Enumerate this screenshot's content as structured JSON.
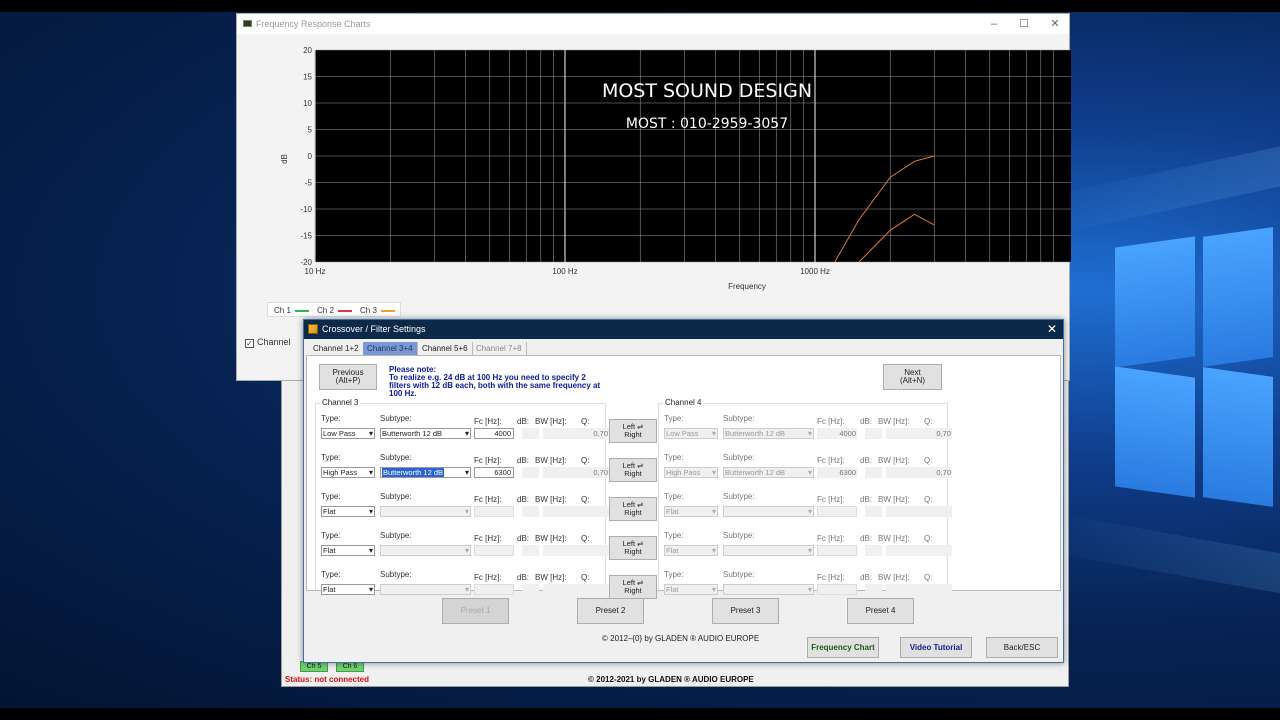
{
  "freq_window": {
    "title": "Frequency Response Charts",
    "controls": [
      "–",
      "☐",
      "✕"
    ],
    "y_label": "dB",
    "x_label": "Frequency",
    "y_ticks": [
      "20",
      "15",
      "10",
      "5",
      "0",
      "-5",
      "-10",
      "-15",
      "-20"
    ],
    "x_ticks": [
      "10 Hz",
      "100 Hz",
      "1000 Hz"
    ],
    "overlay_title": "MOST SOUND DESIGN",
    "overlay_contact": "MOST : 010-2959-3057",
    "legend": [
      {
        "label": "Ch 1",
        "color": "#2db84a"
      },
      {
        "label": "Ch 2",
        "color": "#d8344a"
      },
      {
        "label": "Ch 3",
        "color": "#f0a020"
      }
    ],
    "channel_checkbox": "Channel"
  },
  "chart_data": {
    "type": "line",
    "xlabel": "Frequency",
    "ylabel": "dB",
    "x_scale": "log",
    "xlim": [
      10,
      3000
    ],
    "ylim": [
      -20,
      20
    ],
    "grid": true,
    "series": [
      {
        "color": "#e07a40",
        "x": [
          1200,
          1500,
          2000,
          2500,
          3000
        ],
        "values": [
          -20,
          -12,
          -4,
          -1,
          0
        ]
      },
      {
        "color": "#e07a40",
        "x": [
          1500,
          2000,
          2500,
          3000
        ],
        "values": [
          -20,
          -14,
          -11,
          -13
        ]
      }
    ]
  },
  "bg_app": {
    "status": "Status: not connected",
    "copyright": "© 2012-2021 by GLADEN ® AUDIO EUROPE",
    "buttons": [
      "Ch 5",
      "Ch 6"
    ]
  },
  "crossover": {
    "title": "Crossover / Filter Settings",
    "close": "✕",
    "tabs": [
      "Channel 1+2",
      "Channel 3+4",
      "Channel 5+6",
      "Channel 7+8"
    ],
    "prev_button": "Previous\n(Alt+P)",
    "next_button": "Next\n(Alt+N)",
    "note_title": "Please note:",
    "note_text": "To realize e.g. 24 dB at 100 Hz you need to specify 2 filters with 12 dB each, both with the same frequency at 100 Hz.",
    "left_channel": "Channel 3",
    "right_channel": "Channel 4",
    "labels": {
      "type": "Type:",
      "subtype": "Subtype:",
      "fc": "Fc [Hz]:",
      "db": "dB:",
      "bw": "BW [Hz]:",
      "q": "Q:"
    },
    "lr_button": "Left ⇌\nRight",
    "rows": [
      {
        "type": "Low Pass",
        "subtype": "Butterworth 12 dB",
        "fc": "4000",
        "q": "0,70"
      },
      {
        "type": "High Pass",
        "subtype": "Butterworth 12 dB",
        "fc": "6300",
        "q": "0,70"
      },
      {
        "type": "Flat",
        "subtype": "",
        "fc": "",
        "q": ""
      },
      {
        "type": "Flat",
        "subtype": "",
        "fc": "",
        "q": ""
      },
      {
        "type": "Flat",
        "subtype": "",
        "fc": "",
        "q": ""
      }
    ],
    "presets": [
      "Preset 1",
      "Preset 2",
      "Preset 3",
      "Preset 4"
    ],
    "footer_copy": "© 2012–{0} by GLADEN ® AUDIO EUROPE",
    "buttons": {
      "freq_chart": "Frequency Chart",
      "video": "Video Tutorial",
      "back": "Back/ESC"
    }
  }
}
